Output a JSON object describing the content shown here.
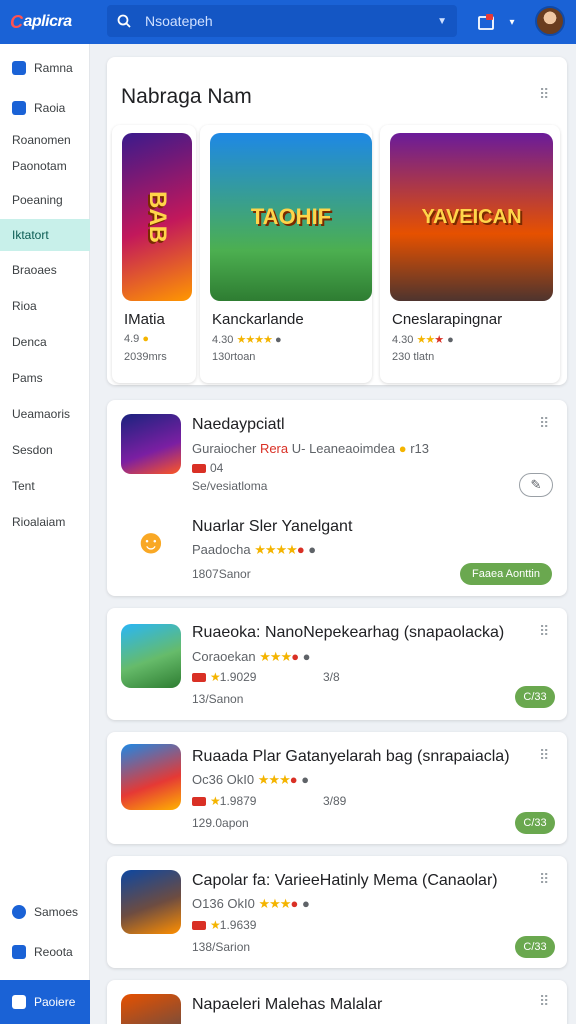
{
  "app": {
    "logo_mark": "C",
    "logo_text": "aplicra"
  },
  "search": {
    "placeholder": "Nsoatepeh"
  },
  "sidebar": {
    "items": [
      {
        "label": "Ramna"
      },
      {
        "label": "Raoia"
      },
      {
        "label": "Roanomen"
      },
      {
        "label": "Paonotam"
      },
      {
        "label": "Poeaning"
      },
      {
        "label": "Iktatort"
      },
      {
        "label": "Braoaes"
      },
      {
        "label": "Rioa"
      },
      {
        "label": "Denca"
      },
      {
        "label": "Pams"
      },
      {
        "label": "Ueamaoris"
      },
      {
        "label": "Sesdon"
      },
      {
        "label": "Tent"
      },
      {
        "label": "Rioalaiam"
      }
    ],
    "bottom": [
      {
        "label": "Samoes"
      },
      {
        "label": "Reoota"
      },
      {
        "label": "Paoiere"
      }
    ]
  },
  "featured": {
    "title": "Nabraga Nam",
    "tiles": [
      {
        "art_text": "BAB",
        "name": "IMatia",
        "rating": "4.9",
        "downloads": "2039mrs"
      },
      {
        "art_text": "TAOHIF",
        "name": "Kanckarlande",
        "rating": "4.30",
        "downloads": "130rtoan"
      },
      {
        "art_text": "YAVEICAN",
        "name": "Cneslarapingnar",
        "rating": "4.30",
        "downloads": "230 tlatn"
      }
    ]
  },
  "list": [
    {
      "name": "Naedaypciatl",
      "sub_prefix": "Guraiocher",
      "sub_highlight": "Rera",
      "sub_suffix": "U-  Leaneaoimdea",
      "sub_count": "r13",
      "rating": "04",
      "developer": "Se/vesiatloma",
      "second_name": "Nuarlar Sler Yanelgant",
      "second_sub": "Paadocha",
      "second_meta": "1807Sanor",
      "second_button": "Faaea Aonttin"
    },
    {
      "name": "Ruaeoka: NanoNepekearhag (snapaolacka)",
      "sub": "Coraoekan",
      "rating": "1.9029",
      "size": "3/8",
      "downloads": "13/Sanon",
      "button": "C/33"
    },
    {
      "name": "Ruaada Plar Gatanyelarah bag (snrapaiacla)",
      "sub": "Oc36 OkI0",
      "rating": "1.9879",
      "size": "3/89",
      "downloads": "129.0apon",
      "button": "C/33"
    },
    {
      "name": "Capolar fa: VarieeHatinly Mema (Canaolar)",
      "sub": "O136 OkI0",
      "rating": "1.9639",
      "size": "",
      "downloads": "138/Sarion",
      "button": "C/33"
    },
    {
      "name": "Napaeleri Malehas Malalar"
    }
  ]
}
